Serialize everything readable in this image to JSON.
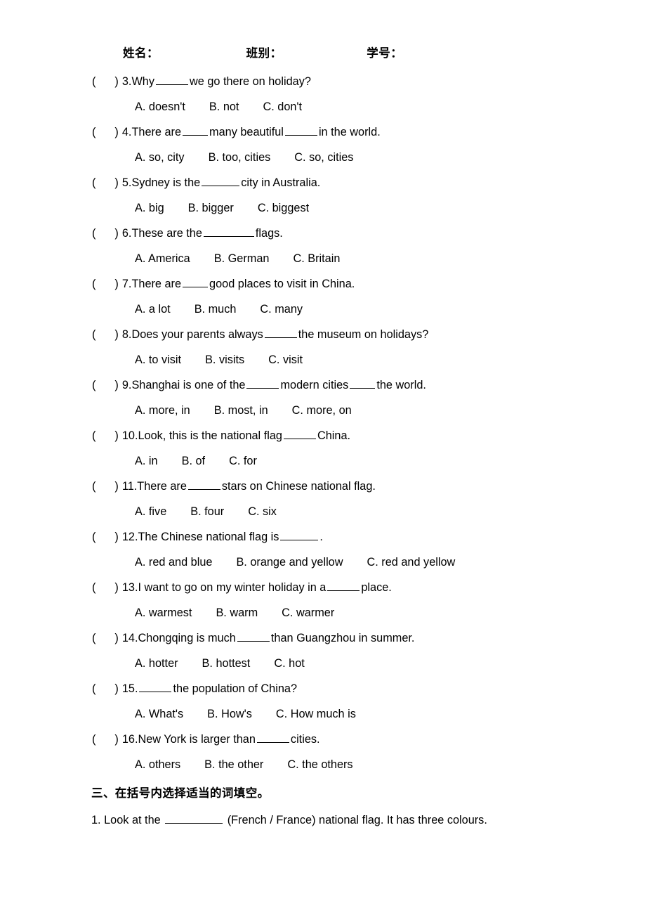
{
  "header": {
    "name_label": "姓名：",
    "class_label": "班别：",
    "student_no_label": "学号："
  },
  "questions": [
    {
      "marker_open": "(",
      "marker_close": ")",
      "number": "3.",
      "stem_before": "Why",
      "blank": "w5",
      "stem_after": "we go there on holiday?",
      "options": [
        "A. doesn't",
        "B. not",
        "C. don't"
      ]
    },
    {
      "marker_open": "(",
      "marker_close": ")",
      "number": "4.",
      "stem_before": "There are",
      "blank": "w4",
      "stem_mid": "many beautiful",
      "blank2": "w5",
      "stem_after": "in the world.",
      "options": [
        "A. so, city",
        "B. too, cities",
        "C. so, cities"
      ]
    },
    {
      "marker_open": "(",
      "marker_close": ")",
      "number": "5.",
      "stem_before": "Sydney is the",
      "blank": "w6",
      "stem_after": "city in Australia.",
      "options": [
        "A. big",
        "B. bigger",
        "C. biggest"
      ]
    },
    {
      "marker_open": "(",
      "marker_close": ")",
      "number": "6.",
      "stem_before": "These are the",
      "blank": "w8",
      "stem_after": "flags.",
      "options": [
        "A. America",
        "B. German",
        "C. Britain"
      ]
    },
    {
      "marker_open": "(",
      "marker_close": ")",
      "number": "7.",
      "stem_before": "There are",
      "blank": "w4",
      "stem_after": "good places to visit in China.",
      "options": [
        "A. a lot",
        "B. much",
        "C. many"
      ]
    },
    {
      "marker_open": "(",
      "marker_close": ")",
      "number": "8.",
      "stem_before": "Does your parents always",
      "blank": "w5",
      "stem_after": "the museum on holidays?",
      "options": [
        "A. to visit",
        "B. visits",
        "C. visit"
      ]
    },
    {
      "marker_open": "(",
      "marker_close": ")",
      "number": "9.",
      "stem_before": "Shanghai is one of the",
      "blank": "w5",
      "stem_mid": "modern cities",
      "blank2": "w4",
      "stem_after": "the world.",
      "options": [
        "A. more, in",
        "B. most, in",
        "C. more, on"
      ]
    },
    {
      "marker_open": "(",
      "marker_close": ")",
      "number": "10.",
      "stem_before": "Look, this is the national flag",
      "blank": "w5",
      "stem_after": "China.",
      "options": [
        "A. in",
        "B. of",
        "C. for"
      ]
    },
    {
      "marker_open": "(",
      "marker_close": ")",
      "number": "11.",
      "stem_before": "There are",
      "blank": "w5",
      "stem_after": "stars on Chinese national flag.",
      "options": [
        "A. five",
        "B. four",
        "C. six"
      ]
    },
    {
      "marker_open": "(",
      "marker_close": ")",
      "number": "12.",
      "stem_before": "The Chinese national flag is",
      "blank": "w6",
      "stem_after": ".",
      "options": [
        "A. red and blue",
        "B. orange and yellow",
        "C. red and yellow"
      ]
    },
    {
      "marker_open": "(",
      "marker_close": ")",
      "number": "13.",
      "stem_before": "I want to go on my winter holiday in a",
      "blank": "w5",
      "stem_after": "place.",
      "options": [
        "A. warmest",
        "B. warm",
        "C. warmer"
      ]
    },
    {
      "marker_open": "(",
      "marker_close": ")",
      "number": "14.",
      "stem_before": "Chongqing is much",
      "blank": "w5",
      "stem_after": "than Guangzhou in summer.",
      "options": [
        "A. hotter",
        "B. hottest",
        "C. hot"
      ]
    },
    {
      "marker_open": "(",
      "marker_close": ")",
      "number": "15.",
      "stem_before": "",
      "blank": "w5",
      "stem_after": "the population of China?",
      "options": [
        "A. What's",
        "B. How's",
        "C. How much is"
      ]
    },
    {
      "marker_open": "(",
      "marker_close": ")",
      "number": "16.",
      "stem_before": "New York is larger than",
      "blank": "w5",
      "stem_after": "cities.",
      "options": [
        "A. others",
        "B. the other",
        "C. the others"
      ]
    }
  ],
  "section": {
    "heading": "三、在括号内选择适当的词填空。"
  },
  "fill_items": [
    {
      "number": "1.",
      "text_before": "Look at the",
      "blank": "w9",
      "text_after": "(French / France) national flag. It has three colours."
    }
  ]
}
